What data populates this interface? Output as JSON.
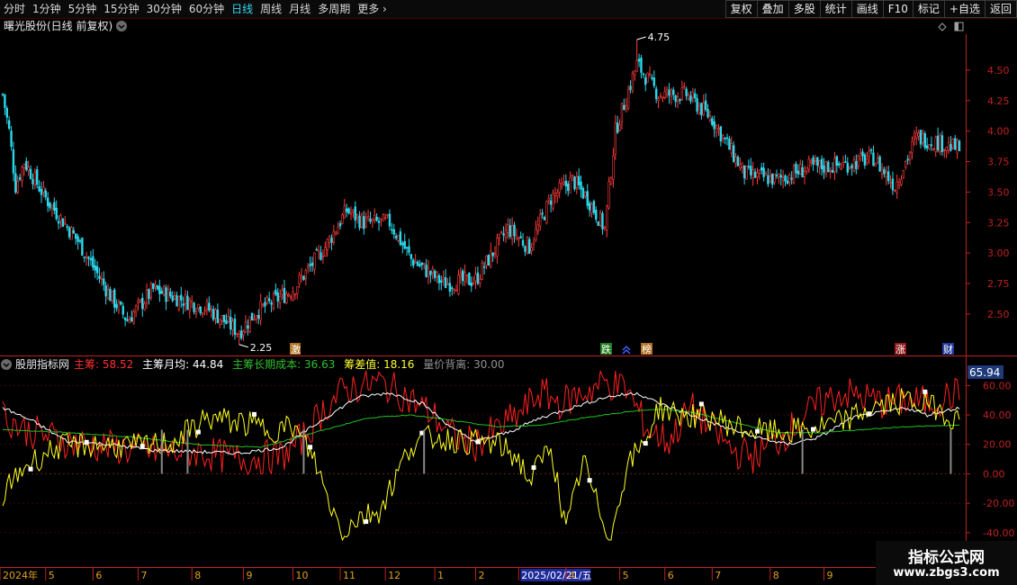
{
  "toolbar": {
    "periods": [
      "分时",
      "1分钟",
      "5分钟",
      "15分钟",
      "30分钟",
      "60分钟",
      "日线",
      "周线",
      "月线",
      "多周期",
      "更多"
    ],
    "active_period": "日线",
    "more_chevron_icon": "chevron-right-icon",
    "actions": [
      "复权",
      "叠加",
      "多股",
      "统计",
      "画线",
      "F10",
      "标记",
      "+自选",
      "返回"
    ]
  },
  "price_panel": {
    "title": "曙光股份(日线 前复权)",
    "high_label": "4.75",
    "low_label": "2.25"
  },
  "markers": {
    "ji": "激",
    "die": "跌",
    "bang": "榜",
    "zhang": "涨",
    "cai": "财"
  },
  "indicator_panel": {
    "name": "股朋指标网",
    "items": [
      {
        "label": "主筹",
        "value": "58.52",
        "color": "#ff3030"
      },
      {
        "label": "主筹月均",
        "value": "44.84",
        "color": "#ffffff"
      },
      {
        "label": "主筹长期成本",
        "value": "36.63",
        "color": "#30c030"
      },
      {
        "label": "筹差值",
        "value": "18.16",
        "color": "#ffff30"
      },
      {
        "label": "量价背离",
        "value": "30.00",
        "color": "#909090"
      }
    ],
    "current_value": "65.94"
  },
  "watermark": {
    "line1": "指标公式网",
    "line2": "www.zbgs3.com"
  },
  "colors": {
    "up": "#ff3b3b",
    "down": "#2ad8ec",
    "axis": "#c02020",
    "main": "#ff2020",
    "avg": "#ffffff",
    "cost": "#20c020",
    "diff": "#ffff20",
    "vol": "#888888"
  },
  "chart_data": [
    {
      "type": "candlestick",
      "title": "曙光股份(日线 前复权)",
      "ylim": [
        2.3,
        4.75
      ],
      "y_ticks": [
        "4.50",
        "4.25",
        "4.00",
        "3.75",
        "3.50",
        "3.25",
        "3.00",
        "2.75",
        "2.50"
      ],
      "x_ticks": [
        "2024年",
        "5",
        "6",
        "7",
        "8",
        "9",
        "10",
        "11",
        "12",
        "1",
        "2",
        "2025/02/21/五",
        "4",
        "5",
        "6",
        "7",
        "8",
        "9"
      ],
      "highlighted_x_label": "2025/02/21/五",
      "trend_close": [
        [
          0,
          4.3
        ],
        [
          3,
          4.0
        ],
        [
          6,
          3.55
        ],
        [
          10,
          3.75
        ],
        [
          20,
          3.45
        ],
        [
          35,
          3.1
        ],
        [
          50,
          2.65
        ],
        [
          58,
          2.45
        ],
        [
          70,
          2.7
        ],
        [
          95,
          2.55
        ],
        [
          110,
          2.35
        ],
        [
          118,
          2.52
        ],
        [
          135,
          2.7
        ],
        [
          150,
          3.05
        ],
        [
          160,
          3.35
        ],
        [
          168,
          3.25
        ],
        [
          180,
          3.25
        ],
        [
          190,
          2.95
        ],
        [
          205,
          2.75
        ],
        [
          220,
          2.78
        ],
        [
          235,
          3.2
        ],
        [
          245,
          3.05
        ],
        [
          255,
          3.45
        ],
        [
          265,
          3.6
        ],
        [
          272,
          3.45
        ],
        [
          280,
          3.2
        ],
        [
          285,
          4.0
        ],
        [
          295,
          4.55
        ],
        [
          305,
          4.3
        ],
        [
          318,
          4.3
        ],
        [
          330,
          4.1
        ],
        [
          345,
          3.65
        ],
        [
          360,
          3.6
        ],
        [
          375,
          3.7
        ],
        [
          390,
          3.72
        ],
        [
          405,
          3.78
        ],
        [
          415,
          3.55
        ],
        [
          425,
          3.95
        ],
        [
          437,
          3.9
        ],
        [
          445,
          3.85
        ]
      ],
      "annotations": [
        {
          "text": "4.75",
          "value": 4.75
        },
        {
          "text": "2.25",
          "value": 2.25
        }
      ]
    },
    {
      "type": "line",
      "title": "股朋指标网",
      "ylim": [
        -45,
        70
      ],
      "y_ticks": [
        "60.00",
        "40.00",
        "20.00",
        "0.00",
        "-20.00",
        "-40.00"
      ],
      "series": [
        {
          "name": "主筹",
          "color": "#ff2020",
          "trend": [
            [
              0,
              40
            ],
            [
              10,
              30
            ],
            [
              30,
              22
            ],
            [
              50,
              18
            ],
            [
              70,
              15
            ],
            [
              90,
              15
            ],
            [
              110,
              10
            ],
            [
              130,
              12
            ],
            [
              140,
              25
            ],
            [
              150,
              45
            ],
            [
              160,
              58
            ],
            [
              175,
              62
            ],
            [
              185,
              55
            ],
            [
              200,
              40
            ],
            [
              210,
              25
            ],
            [
              220,
              20
            ],
            [
              230,
              30
            ],
            [
              240,
              40
            ],
            [
              250,
              55
            ],
            [
              260,
              48
            ],
            [
              270,
              55
            ],
            [
              280,
              62
            ],
            [
              290,
              58
            ],
            [
              300,
              30
            ],
            [
              310,
              22
            ],
            [
              320,
              45
            ],
            [
              330,
              30
            ],
            [
              340,
              15
            ],
            [
              350,
              12
            ],
            [
              360,
              22
            ],
            [
              370,
              35
            ],
            [
              380,
              48
            ],
            [
              390,
              55
            ],
            [
              400,
              52
            ],
            [
              410,
              48
            ],
            [
              420,
              50
            ],
            [
              430,
              48
            ],
            [
              445,
              55
            ]
          ]
        },
        {
          "name": "主筹月均",
          "color": "#ffffff",
          "trend": [
            [
              0,
              45
            ],
            [
              15,
              35
            ],
            [
              30,
              22
            ],
            [
              50,
              20
            ],
            [
              70,
              16
            ],
            [
              90,
              15
            ],
            [
              110,
              14
            ],
            [
              130,
              18
            ],
            [
              150,
              38
            ],
            [
              165,
              52
            ],
            [
              180,
              55
            ],
            [
              195,
              48
            ],
            [
              210,
              30
            ],
            [
              220,
              22
            ],
            [
              235,
              28
            ],
            [
              250,
              38
            ],
            [
              265,
              45
            ],
            [
              280,
              52
            ],
            [
              295,
              55
            ],
            [
              305,
              48
            ],
            [
              320,
              40
            ],
            [
              335,
              32
            ],
            [
              350,
              25
            ],
            [
              365,
              20
            ],
            [
              380,
              25
            ],
            [
              395,
              38
            ],
            [
              410,
              42
            ],
            [
              420,
              45
            ],
            [
              430,
              40
            ],
            [
              445,
              45
            ]
          ]
        },
        {
          "name": "主筹长期成本",
          "color": "#20c020",
          "trend": [
            [
              0,
              30
            ],
            [
              30,
              28
            ],
            [
              60,
              25
            ],
            [
              90,
              20
            ],
            [
              120,
              18
            ],
            [
              150,
              30
            ],
            [
              170,
              38
            ],
            [
              190,
              40
            ],
            [
              210,
              36
            ],
            [
              230,
              32
            ],
            [
              250,
              33
            ],
            [
              270,
              38
            ],
            [
              290,
              42
            ],
            [
              305,
              44
            ],
            [
              320,
              42
            ],
            [
              340,
              35
            ],
            [
              360,
              28
            ],
            [
              380,
              28
            ],
            [
              400,
              30
            ],
            [
              420,
              32
            ],
            [
              445,
              33
            ]
          ]
        },
        {
          "name": "筹差值",
          "color": "#ffff20",
          "trend": [
            [
              0,
              -15
            ],
            [
              10,
              5
            ],
            [
              25,
              18
            ],
            [
              45,
              20
            ],
            [
              65,
              18
            ],
            [
              80,
              22
            ],
            [
              95,
              38
            ],
            [
              110,
              35
            ],
            [
              125,
              30
            ],
            [
              135,
              32
            ],
            [
              145,
              10
            ],
            [
              150,
              -12
            ],
            [
              158,
              -40
            ],
            [
              165,
              -30
            ],
            [
              175,
              -25
            ],
            [
              182,
              -5
            ],
            [
              190,
              20
            ],
            [
              200,
              25
            ],
            [
              215,
              22
            ],
            [
              230,
              20
            ],
            [
              240,
              10
            ],
            [
              245,
              -5
            ],
            [
              255,
              20
            ],
            [
              262,
              -40
            ],
            [
              270,
              10
            ],
            [
              275,
              -15
            ],
            [
              283,
              -45
            ],
            [
              290,
              5
            ],
            [
              298,
              20
            ],
            [
              305,
              45
            ],
            [
              315,
              40
            ],
            [
              330,
              38
            ],
            [
              345,
              30
            ],
            [
              360,
              28
            ],
            [
              375,
              30
            ],
            [
              390,
              35
            ],
            [
              405,
              45
            ],
            [
              420,
              50
            ],
            [
              435,
              45
            ],
            [
              445,
              35
            ]
          ]
        },
        {
          "name": "量价背离",
          "color": "#888888",
          "bars": [
            [
              74,
              30
            ],
            [
              86,
              30
            ],
            [
              140,
              30
            ],
            [
              196,
              30
            ],
            [
              372,
              30
            ],
            [
              441,
              30
            ]
          ]
        }
      ]
    }
  ]
}
